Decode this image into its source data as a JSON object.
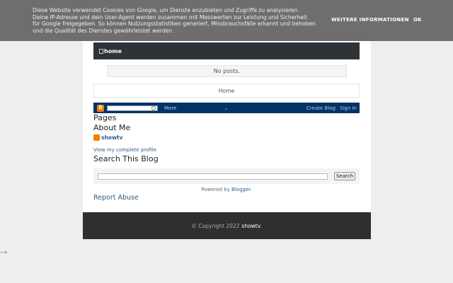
{
  "cookie_banner": {
    "text": "Diese Website verwendet Cookies von Google, um Dienste anzubieten und Zugriffe zu analysieren. Deine IP-Adresse und dein User-Agent werden zusammen mit Messwerten zur Leistung und Sicherheit für Google freigegeben. So können Nutzungsstatistiken generiert, Missbrauchsfälle erkannt und behoben und die Qualität des Dienstes gewährleistet werden.",
    "more_info_label": "WEITERE INFORMATIONEN",
    "ok_label": "OK"
  },
  "navbar": {
    "home_label": "home"
  },
  "main": {
    "no_posts": "No posts.",
    "home_link": "Home"
  },
  "blogger_bar": {
    "more_label": "More",
    "chevron": "⌄",
    "create_blog": "Create Blog",
    "sign_in": "Sign In"
  },
  "sidebar": {
    "pages_title": "Pages",
    "about_title": "About Me",
    "profile_name": "showtv",
    "view_profile": "View my complete profile",
    "search_title": "Search This Blog",
    "search_button": "Search"
  },
  "powered": {
    "prefix": "Powered by ",
    "link": "Blogger",
    "suffix": "."
  },
  "report_abuse": "Report Abuse",
  "footer": {
    "copyright": "© Copyright 2022",
    "name": "showtv",
    "suffix": "."
  },
  "stray_text": "-->"
}
